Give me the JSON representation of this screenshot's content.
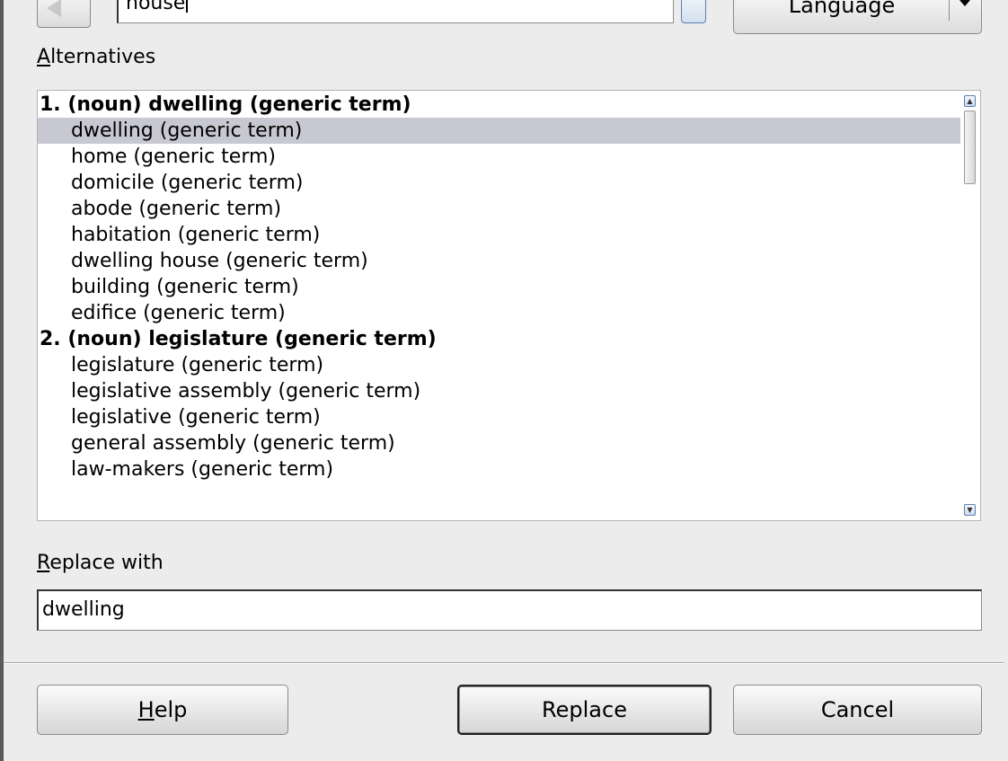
{
  "header": {
    "word_value": "house",
    "language_label": "Language"
  },
  "alternatives": {
    "label": "Alternatives",
    "rows": [
      {
        "text": "1. (noun) dwelling (generic term)",
        "kind": "head"
      },
      {
        "text": "dwelling (generic term)",
        "kind": "item",
        "selected": true
      },
      {
        "text": "home (generic term)",
        "kind": "item"
      },
      {
        "text": "domicile (generic term)",
        "kind": "item"
      },
      {
        "text": "abode (generic term)",
        "kind": "item"
      },
      {
        "text": "habitation (generic term)",
        "kind": "item"
      },
      {
        "text": "dwelling house (generic term)",
        "kind": "item"
      },
      {
        "text": "building (generic term)",
        "kind": "item"
      },
      {
        "text": "edifice (generic term)",
        "kind": "item"
      },
      {
        "text": "2. (noun) legislature (generic term)",
        "kind": "head"
      },
      {
        "text": "legislature (generic term)",
        "kind": "item"
      },
      {
        "text": "legislative assembly (generic term)",
        "kind": "item"
      },
      {
        "text": "legislative (generic term)",
        "kind": "item"
      },
      {
        "text": "general assembly (generic term)",
        "kind": "item"
      },
      {
        "text": "law-makers (generic term)",
        "kind": "item"
      }
    ]
  },
  "replace": {
    "label": "Replace with",
    "value": "dwelling"
  },
  "buttons": {
    "help": "Help",
    "replace": "Replace",
    "cancel": "Cancel"
  },
  "icons": [
    "back-arrow-icon",
    "dropdown-arrow-icon",
    "scroll-up-icon",
    "scroll-down-icon"
  ]
}
